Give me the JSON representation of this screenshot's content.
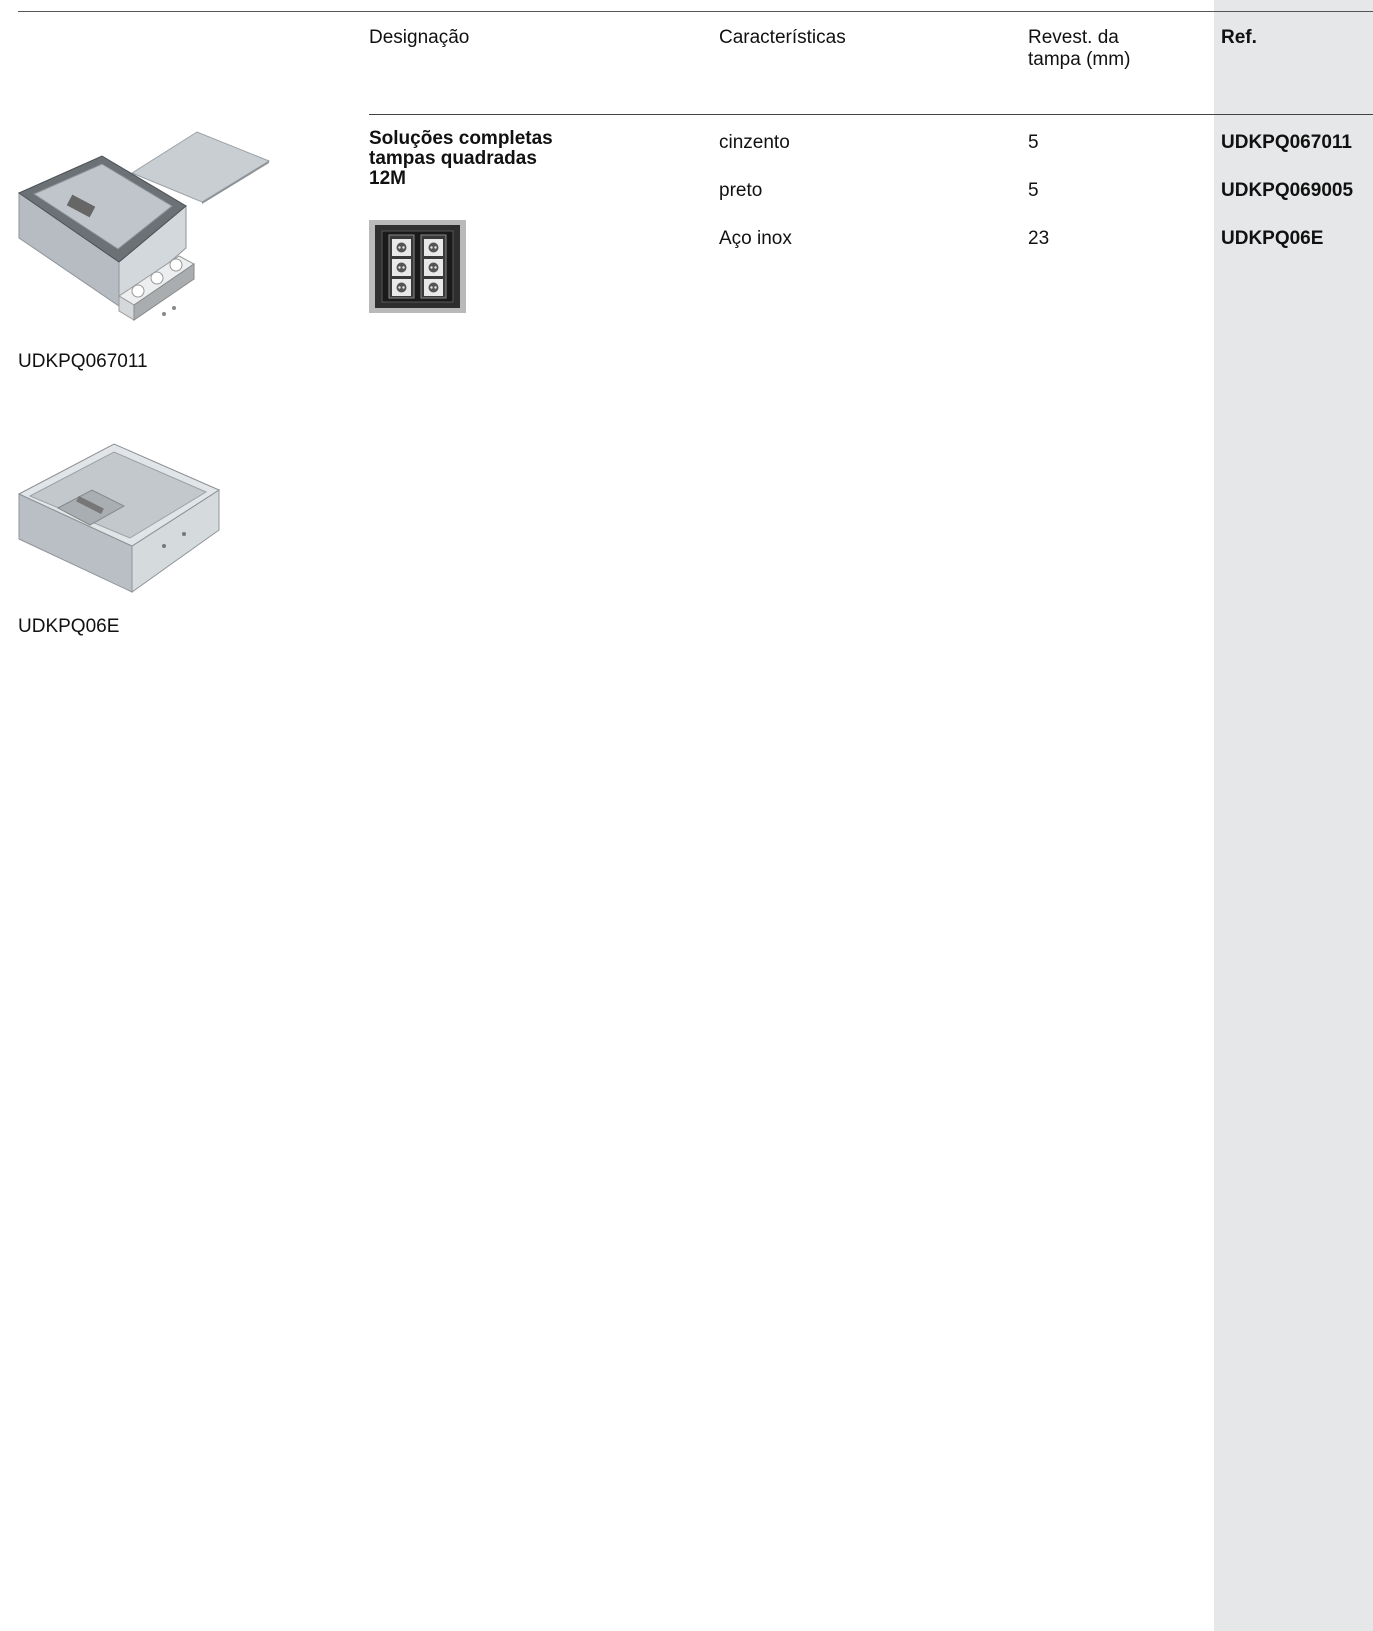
{
  "header": {
    "col_designation": "Designação",
    "col_characteristics": "Características",
    "col_coating_line1": "Revest. da",
    "col_coating_line2": "tampa (mm)",
    "col_ref": "Ref."
  },
  "designation": {
    "line1": "Soluções completas",
    "line2": "tampas quadradas",
    "line3": "12M"
  },
  "rows": [
    {
      "characteristic": "cinzento",
      "coating": "5",
      "ref": "UDKPQ067011"
    },
    {
      "characteristic": "preto",
      "coating": "5",
      "ref": "UDKPQ069005"
    },
    {
      "characteristic": "Aço inox",
      "coating": "23",
      "ref": "UDKPQ06E"
    }
  ],
  "products": [
    {
      "caption": "UDKPQ067011",
      "icon": "floor-box-with-cover-image"
    },
    {
      "caption": "UDKPQ06E",
      "icon": "stainless-floor-box-image"
    }
  ],
  "thumbnail_icon": "socket-insert-thumbnail",
  "colors": {
    "ref_band": "#e6e7e8",
    "rule": "#444444"
  }
}
